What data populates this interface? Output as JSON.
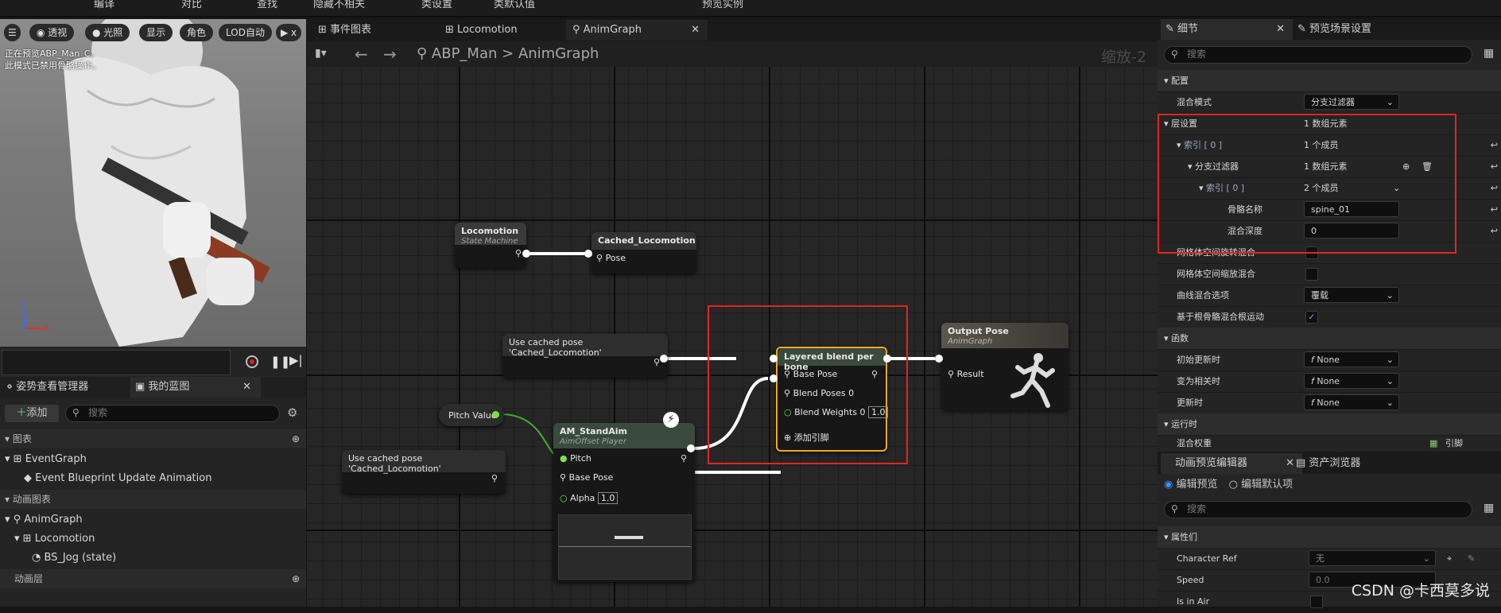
{
  "topbar": {
    "items": [
      "编译",
      "对比",
      "查找",
      "隐藏不相关",
      "类设置",
      "类默认值",
      "预览实例"
    ]
  },
  "viewport": {
    "buttons": [
      "透视",
      "光照",
      "显示",
      "角色",
      "LOD自动",
      "x"
    ],
    "message_line1": "正在预览ABP_Man_C。",
    "message_line2": "此模式已禁用骨骼操作。",
    "axis": {
      "z": "Z",
      "x": "X"
    }
  },
  "left_panel": {
    "tabs": [
      "姿势查看管理器",
      "我的蓝图"
    ],
    "add_label": "添加",
    "search_placeholder": "搜索",
    "sections": {
      "graphs": "图表",
      "anim_graphs": "动画图表",
      "anim_layers": "动画层"
    },
    "items": {
      "event_graph": "EventGraph",
      "event_update": "Event Blueprint Update Animation",
      "anim_graph": "AnimGraph",
      "locomotion": "Locomotion",
      "bs_jog": "BS_Jog (state)"
    }
  },
  "graph_tabs": [
    "事件图表",
    "Locomotion",
    "AnimGraph"
  ],
  "breadcrumb": {
    "root": "ABP_Man",
    "current": "AnimGraph"
  },
  "zoom": "缩放-2",
  "nodes": {
    "locomotion": {
      "title": "Locomotion",
      "subtitle": "State Machine"
    },
    "cached": {
      "title": "Cached_Locomotion",
      "pin": "Pose"
    },
    "use_cached_1": {
      "title": "Use cached pose 'Cached_Locomotion'"
    },
    "use_cached_2": {
      "title": "Use cached pose 'Cached_Locomotion'"
    },
    "pitch_value": {
      "title": "Pitch Value"
    },
    "aim": {
      "title": "AM_StandAim",
      "subtitle": "AimOffset Player",
      "pin_pitch": "Pitch",
      "pin_base": "Base Pose",
      "pin_alpha": "Alpha",
      "alpha_value": "1.0"
    },
    "layered": {
      "title": "Layered blend per bone",
      "pin_base": "Base Pose",
      "pin_blend_poses": "Blend Poses 0",
      "pin_blend_weights": "Blend Weights 0",
      "weight_value": "1.0",
      "add_pin": "添加引脚"
    },
    "output": {
      "title": "Output Pose",
      "subtitle": "AnimGraph",
      "pin": "Result"
    }
  },
  "details": {
    "tabs": [
      "细节",
      "预览场景设置"
    ],
    "search_placeholder": "搜索",
    "rows": {
      "config": "配置",
      "blend_mode": {
        "label": "混合模式",
        "value": "分支过滤器"
      },
      "layer_setup": {
        "label": "层设置",
        "value": "1 数组元素"
      },
      "index0": {
        "label": "索引 [ 0 ]",
        "value": "1 个成员"
      },
      "branch_filters": {
        "label": "分支过滤器",
        "value": "1 数组元素"
      },
      "index0b": {
        "label": "索引 [ 0 ]",
        "value": "2 个成员"
      },
      "bone_name": {
        "label": "骨骼名称",
        "value": "spine_01"
      },
      "blend_depth": {
        "label": "混合深度",
        "value": "0"
      },
      "mesh_rot": "网格体空间旋转混合",
      "mesh_scale": "网格体空间缩放混合",
      "curve_blend": {
        "label": "曲线混合选项",
        "value": "覆载"
      },
      "root_motion": "基于根骨骼混合根运动",
      "functions": "函数",
      "initial_update": {
        "label": "初始更新时",
        "value": "None"
      },
      "become_relevant": {
        "label": "变为相关时",
        "value": "None"
      },
      "on_update": {
        "label": "更新时",
        "value": "None"
      },
      "runtime": "运行时",
      "blend_weights": {
        "label": "混合权重",
        "value": "引脚"
      }
    }
  },
  "preview": {
    "tabs": [
      "动画预览编辑器",
      "资产浏览器"
    ],
    "radio_edit": "编辑预览",
    "radio_default": "编辑默认项",
    "search_placeholder": "搜索",
    "section": "属性们",
    "character_ref": {
      "label": "Character Ref",
      "value": "无"
    },
    "speed": {
      "label": "Speed",
      "value": "0.0"
    },
    "in_air": {
      "label": "Is in Air"
    }
  },
  "watermark": "CSDN @卡西莫多说",
  "colors": {
    "red_highlight": "#e0261f",
    "node_header_green": "#3a4a3c",
    "selected_border": "#f2a81d",
    "pin_green": "#7ee048"
  }
}
